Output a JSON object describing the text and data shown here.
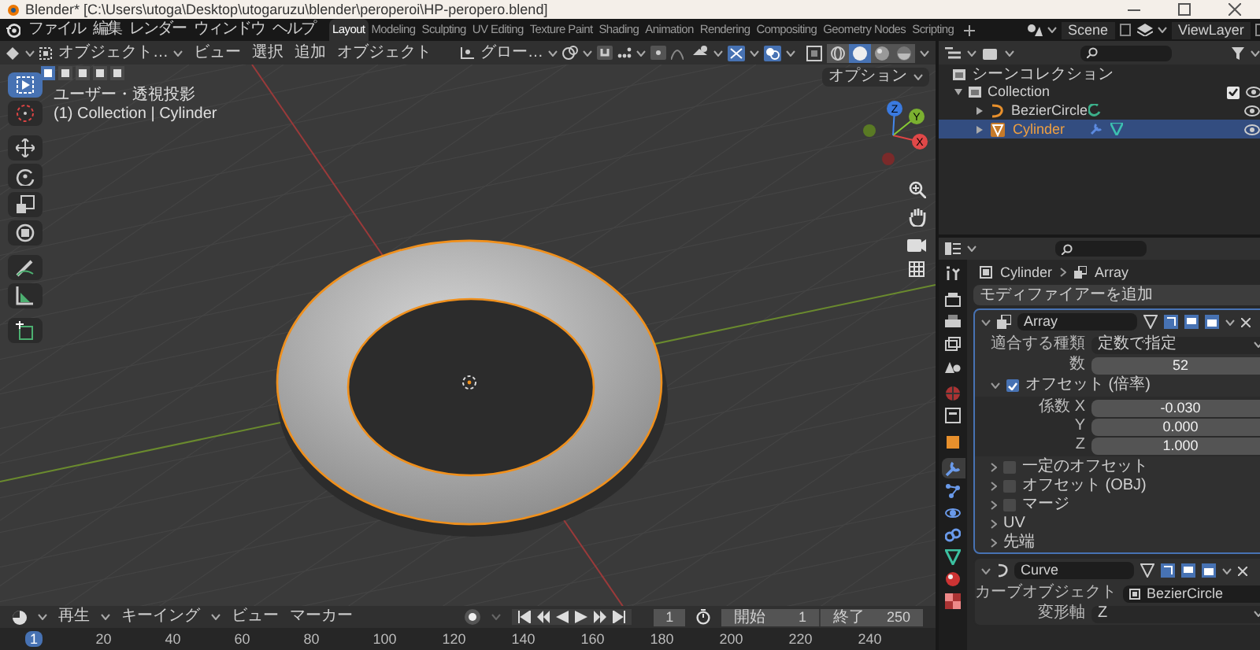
{
  "window": {
    "title": "Blender* [C:\\Users\\utoga\\Desktop\\utogaruzu\\blender\\peroperoi\\HP-peropero.blend]"
  },
  "menu_bar": {
    "items": [
      "ファイル",
      "編集",
      "レンダー",
      "ウィンドウ",
      "ヘルプ"
    ]
  },
  "workspaces": [
    {
      "label": "Layout",
      "selected": true
    },
    {
      "label": "Modeling",
      "selected": false
    },
    {
      "label": "Sculpting",
      "selected": false
    },
    {
      "label": "UV Editing",
      "selected": false
    },
    {
      "label": "Texture Paint",
      "selected": false
    },
    {
      "label": "Shading",
      "selected": false
    },
    {
      "label": "Animation",
      "selected": false
    },
    {
      "label": "Rendering",
      "selected": false
    },
    {
      "label": "Compositing",
      "selected": false
    },
    {
      "label": "Geometry Nodes",
      "selected": false
    },
    {
      "label": "Scripting",
      "selected": false
    }
  ],
  "scene": "Scene",
  "view_layer": "ViewLayer",
  "viewport": {
    "mode": "オブジェクト…",
    "menus": [
      "ビュー",
      "選択",
      "追加",
      "オブジェクト"
    ],
    "orientation": "グロー…",
    "options": "オプション",
    "overlay_text": [
      "ユーザー・透視投影",
      "(1) Collection | Cylinder"
    ],
    "shading_modes": [
      {
        "selected": false
      },
      {
        "selected": true
      },
      {
        "selected": false
      },
      {
        "selected": false
      }
    ],
    "tools": [
      {
        "selected": true
      },
      {
        "selected": false
      },
      {
        "selected": false
      },
      {
        "selected": false
      },
      {
        "selected": false
      },
      {
        "selected": false
      },
      {
        "selected": false
      },
      {
        "selected": false
      },
      {
        "selected": false
      }
    ],
    "gizmo_axes": [
      "X",
      "Y",
      "Z"
    ]
  },
  "outliner": {
    "root": "シーンコレクション",
    "children": [
      {
        "label": "Collection",
        "expanded": true,
        "checked": true,
        "children": [
          {
            "label": "BezierCircle",
            "kind": "curve",
            "selected": false
          },
          {
            "label": "Cylinder",
            "kind": "mesh",
            "selected": true
          }
        ]
      }
    ]
  },
  "properties": {
    "tabs": [
      {
        "kind": "tool",
        "selected": false
      },
      {
        "kind": "render",
        "selected": false
      },
      {
        "kind": "output",
        "selected": false
      },
      {
        "kind": "view_layer",
        "selected": false
      },
      {
        "kind": "scene",
        "selected": false
      },
      {
        "kind": "world",
        "selected": false
      },
      {
        "kind": "collection",
        "selected": false
      },
      {
        "kind": "object",
        "selected": false
      },
      {
        "kind": "modifier",
        "selected": true
      },
      {
        "kind": "particles",
        "selected": false
      },
      {
        "kind": "physics",
        "selected": false
      },
      {
        "kind": "constraints",
        "selected": false
      },
      {
        "kind": "data",
        "selected": false
      },
      {
        "kind": "material",
        "selected": false
      },
      {
        "kind": "texture",
        "selected": false
      }
    ],
    "breadcrumb": [
      "Cylinder",
      "Array"
    ],
    "add_modifier": "モディファイアーを追加",
    "modifiers": [
      {
        "kind": "array",
        "name": "Array",
        "active": true,
        "expanded": true,
        "fields": [
          {
            "label": "適合する種類",
            "value": "定数で指定",
            "kind": "dropdown"
          },
          {
            "label": "数",
            "value": "52",
            "kind": "number"
          }
        ],
        "offset": {
          "label": "オフセット (倍率)",
          "checked": true,
          "expanded": true,
          "fields": [
            {
              "label": "係数 X",
              "value": "-0.030"
            },
            {
              "label": "Y",
              "value": "0.000"
            },
            {
              "label": "Z",
              "value": "1.000"
            }
          ]
        },
        "subpanels": [
          {
            "label": "一定のオフセット",
            "kind": "checkbox",
            "checked": false
          },
          {
            "label": "オフセット (OBJ)",
            "kind": "checkbox",
            "checked": false
          },
          {
            "label": "マージ",
            "kind": "checkbox",
            "checked": false
          },
          {
            "label": "UV",
            "kind": "plain"
          },
          {
            "label": "先端",
            "kind": "plain"
          }
        ]
      },
      {
        "kind": "curve",
        "name": "Curve",
        "active": false,
        "expanded": true,
        "fields": [
          {
            "label": "カーブオブジェクト",
            "value": "BezierCircle",
            "kind": "object"
          },
          {
            "label": "変形軸",
            "value": "Z",
            "kind": "dropdown"
          }
        ]
      }
    ]
  },
  "timeline": {
    "menus": [
      "再生",
      "キーイング",
      "ビュー",
      "マーカー"
    ],
    "current_frame": "1",
    "start_label": "開始",
    "start": "1",
    "end_label": "終了",
    "end": "250",
    "ruler": [
      "1",
      "20",
      "40",
      "60",
      "80",
      "100",
      "120",
      "140",
      "160",
      "180",
      "200",
      "220",
      "240"
    ]
  }
}
